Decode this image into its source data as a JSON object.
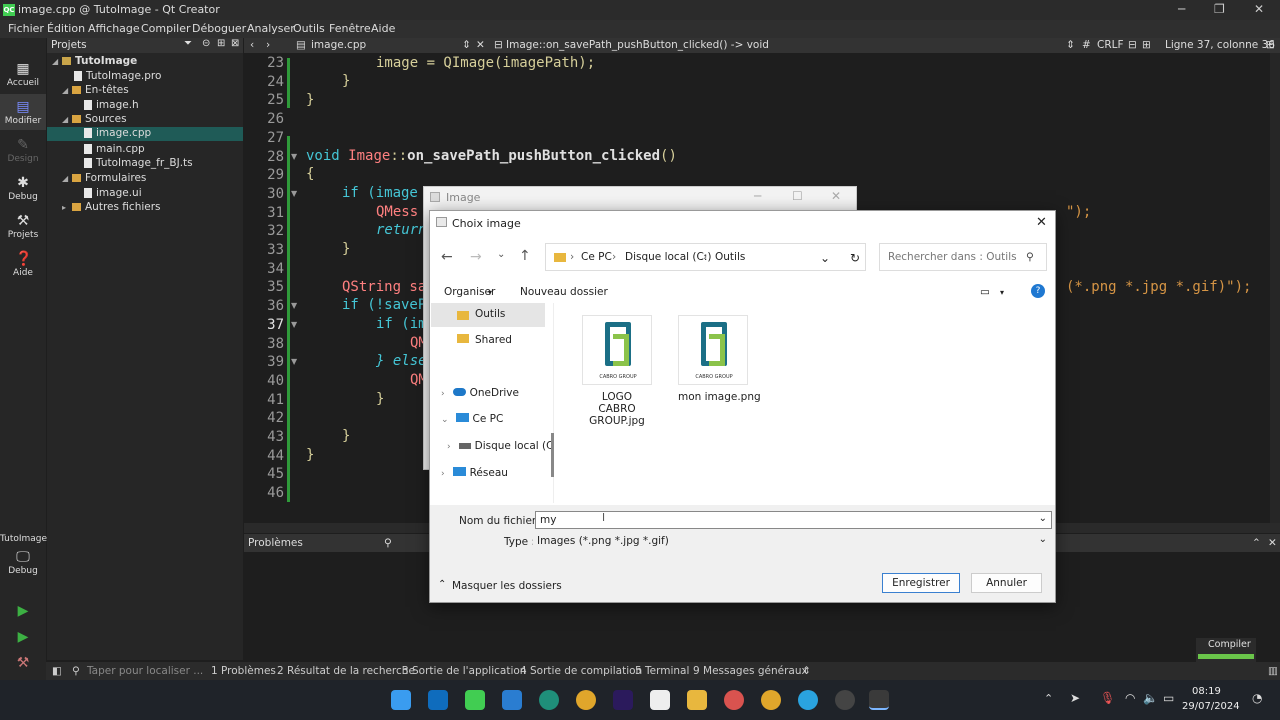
{
  "window": {
    "title": "image.cpp @ TutoImage - Qt Creator",
    "app_icon": "QC"
  },
  "menu": [
    "Fichier",
    "Édition",
    "Affichage",
    "Compiler",
    "Déboguer",
    "Analyser",
    "Outils",
    "Fenêtre",
    "Aide"
  ],
  "modes": [
    {
      "label": "Accueil",
      "icon": "grid-icon"
    },
    {
      "label": "Modifier",
      "icon": "edit-icon"
    },
    {
      "label": "Design",
      "icon": "pencil-icon"
    },
    {
      "label": "Debug",
      "icon": "bug-icon"
    },
    {
      "label": "Projets",
      "icon": "wrench-icon"
    },
    {
      "label": "Aide",
      "icon": "help-icon"
    }
  ],
  "kit": {
    "project": "TutoImage",
    "config": "Debug"
  },
  "projects_panel": {
    "header": "Projets",
    "tree": [
      {
        "label": "TutoImage",
        "type": "project"
      },
      {
        "label": "TutoImage.pro",
        "type": "file"
      },
      {
        "label": "En-têtes",
        "type": "folder"
      },
      {
        "label": "image.h",
        "type": "file"
      },
      {
        "label": "Sources",
        "type": "folder"
      },
      {
        "label": "image.cpp",
        "type": "file",
        "selected": true
      },
      {
        "label": "main.cpp",
        "type": "file"
      },
      {
        "label": "TutoImage_fr_BJ.ts",
        "type": "file"
      },
      {
        "label": "Formulaires",
        "type": "folder"
      },
      {
        "label": "image.ui",
        "type": "file"
      },
      {
        "label": "Autres fichiers",
        "type": "folder"
      }
    ]
  },
  "editor": {
    "file": "image.cpp",
    "function": "Image::on_savePath_pushButton_clicked() -> void",
    "line_ending": "CRLF",
    "position": "Ligne 37, colonne 36",
    "line_numbers": [
      "23",
      "24",
      "25",
      "26",
      "27",
      "28",
      "29",
      "30",
      "31",
      "32",
      "33",
      "34",
      "35",
      "36",
      "37",
      "38",
      "39",
      "40",
      "41",
      "42",
      "43",
      "44",
      "45",
      "46"
    ],
    "code_visible": {
      "l23": "image = QImage(imagePath);",
      "l24": "}",
      "l25": "}",
      "l28a": "void ",
      "l28b": "Image",
      "l28c": "::",
      "l28d": "on_savePath_pushButton_clicked",
      "l28e": "()",
      "l29": "{",
      "l30": "if (image",
      "l31": "QMess",
      "l31r": "\");",
      "l32": "return",
      "l33": "}",
      "l35": "QString sa",
      "l35r": "(*.png *.jpg *.gif)\");",
      "l36": "if (!saveP",
      "l37": "if (im",
      "l38": "QM",
      "l39": "} else",
      "l40": "QM",
      "l41": "}",
      "l43": "}",
      "l44": "}"
    }
  },
  "output_header": {
    "title": "Problèmes"
  },
  "bottom_tabs": [
    "1 Problèmes",
    "2 Résultat de la recherche",
    "3 Sortie de l'application",
    "4 Sortie de compilation",
    "5 Terminal",
    "9 Messages généraux"
  ],
  "locator_placeholder": "Taper pour localiser ...",
  "compile_indicator": "Compiler",
  "bg_dialog": {
    "title": "Image"
  },
  "file_dialog": {
    "title": "Choix image",
    "breadcrumb": [
      "Ce PC",
      "Disque local (C:)",
      "Outils"
    ],
    "search_placeholder": "Rechercher dans : Outils",
    "organize": "Organiser",
    "new_folder": "Nouveau dossier",
    "nav_items": [
      {
        "label": "Outils",
        "selected": true
      },
      {
        "label": "Shared"
      },
      {
        "label": "OneDrive"
      },
      {
        "label": "Ce PC"
      },
      {
        "label": "Disque local (C"
      },
      {
        "label": "Réseau"
      }
    ],
    "files": [
      {
        "name": "LOGO CABRO GROUP.jpg",
        "thumb_text": "CABRO GROUP"
      },
      {
        "name": "mon image.png",
        "thumb_text": "CABRO GROUP"
      }
    ],
    "filename_label": "Nom du fichier :",
    "filename_value": "my",
    "type_label": "Type :",
    "type_value": "Images (*.png *.jpg *.gif)",
    "hide_folders": "Masquer les dossiers",
    "save_button": "Enregistrer",
    "cancel_button": "Annuler"
  },
  "taskbar": {
    "time": "08:19",
    "date": "29/07/2024"
  },
  "colors": {
    "accent": "#1f5b57",
    "green": "#2f9b3a",
    "button_primary": "#3a80d0"
  }
}
